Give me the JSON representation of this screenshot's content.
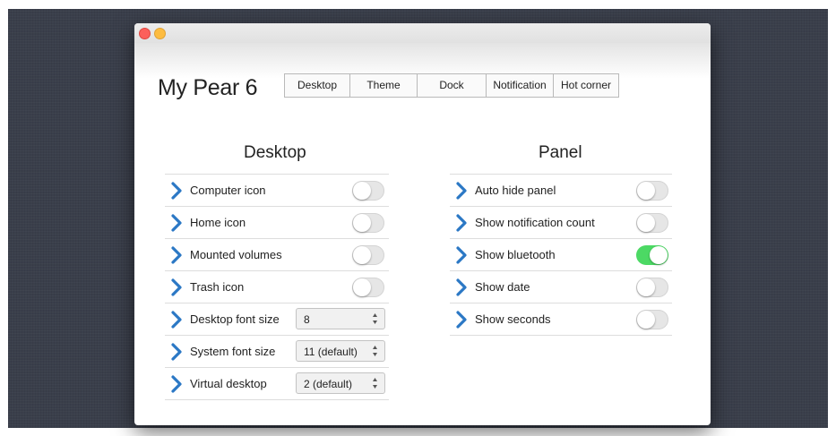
{
  "app_title": "My Pear 6",
  "tabs": [
    {
      "label": "Desktop"
    },
    {
      "label": "Theme"
    },
    {
      "label": "Dock"
    },
    {
      "label": "Notification"
    },
    {
      "label": "Hot corner"
    }
  ],
  "desktop": {
    "title": "Desktop",
    "items": [
      {
        "label": "Computer icon",
        "control": "toggle",
        "on": false
      },
      {
        "label": "Home icon",
        "control": "toggle",
        "on": false
      },
      {
        "label": "Mounted volumes",
        "control": "toggle",
        "on": false
      },
      {
        "label": "Trash icon",
        "control": "toggle",
        "on": false
      },
      {
        "label": "Desktop font size",
        "control": "select",
        "value": "8"
      },
      {
        "label": "System font size",
        "control": "select",
        "value": "11 (default)"
      },
      {
        "label": "Virtual desktop",
        "control": "select",
        "value": "2 (default)"
      }
    ]
  },
  "panel": {
    "title": "Panel",
    "items": [
      {
        "label": "Auto hide panel",
        "on": false
      },
      {
        "label": "Show notification count",
        "on": false
      },
      {
        "label": "Show bluetooth",
        "on": true
      },
      {
        "label": "Show date",
        "on": false
      },
      {
        "label": "Show seconds",
        "on": false
      }
    ]
  },
  "colors": {
    "accent_chevron": "#2b78c5",
    "toggle_on": "#4cd964",
    "close_button": "#fc605b",
    "minimize_button": "#fdbc40"
  }
}
